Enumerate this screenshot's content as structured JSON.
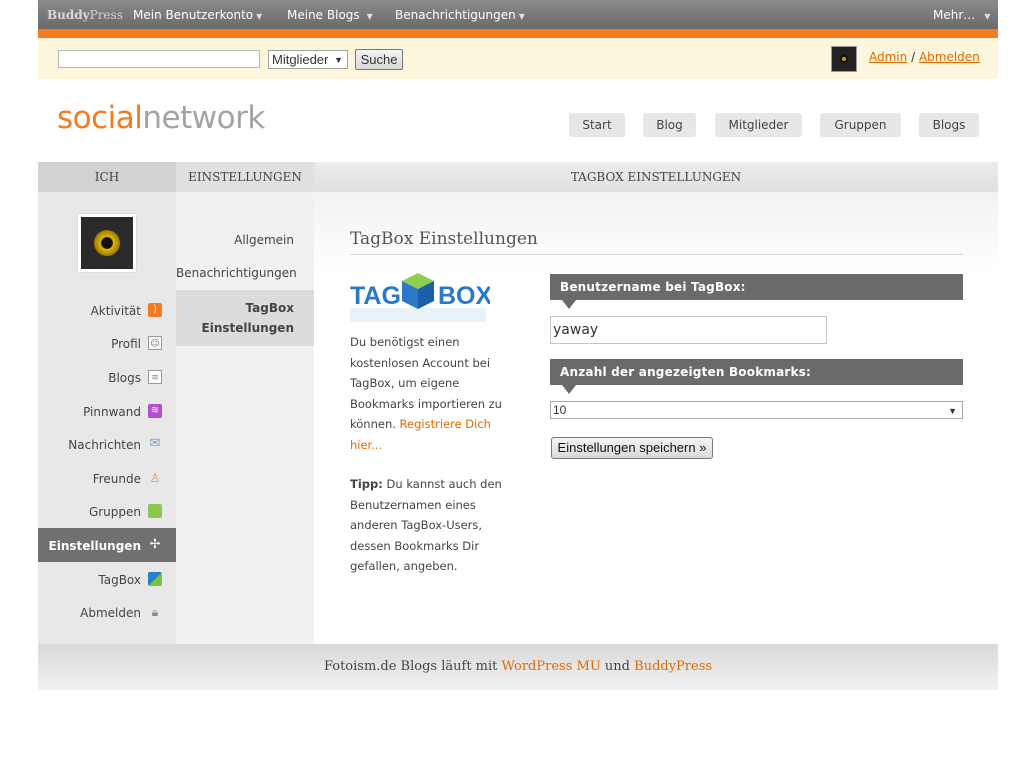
{
  "adminbar": {
    "logo_bold": "Buddy",
    "logo_rest": "Press",
    "items": [
      {
        "label": "Mein Benutzerkonto"
      },
      {
        "label": "Meine Blogs"
      },
      {
        "label": "Benachrichtigungen"
      }
    ],
    "more_label": "Mehr…",
    "accent_color": "#f47b20"
  },
  "search": {
    "input_value": "",
    "scope_selected": "Mitglieder",
    "button_label": "Suche"
  },
  "user": {
    "admin_link": "Admin",
    "separator": "/",
    "logout_link": "Abmelden"
  },
  "header": {
    "logo_part1": "social",
    "logo_part2": "network",
    "nav": [
      "Start",
      "Blog",
      "Mitglieder",
      "Gruppen",
      "Blogs"
    ]
  },
  "columns": {
    "ich": "ICH",
    "einstellungen": "EINSTELLUNGEN",
    "main": "TAGBOX EINSTELLUNGEN"
  },
  "sidebar": {
    "items": [
      {
        "label": "Aktivität",
        "icon": "rss-icon"
      },
      {
        "label": "Profil",
        "icon": "profile-icon"
      },
      {
        "label": "Blogs",
        "icon": "blogs-icon"
      },
      {
        "label": "Pinnwand",
        "icon": "wire-icon"
      },
      {
        "label": "Nachrichten",
        "icon": "mail-icon"
      },
      {
        "label": "Freunde",
        "icon": "friends-icon"
      },
      {
        "label": "Gruppen",
        "icon": "groups-icon"
      },
      {
        "label": "Einstellungen",
        "icon": "settings-icon",
        "active": true
      },
      {
        "label": "TagBox",
        "icon": "tagbox-icon"
      },
      {
        "label": "Abmelden",
        "icon": "lock-icon"
      }
    ]
  },
  "subnav": {
    "items": [
      {
        "label": "Allgemein"
      },
      {
        "label": "Benachrichtigungen"
      },
      {
        "label_line1": "TagBox",
        "label_line2": "Einstellungen",
        "active": true
      }
    ]
  },
  "main": {
    "title": "TagBox Einstellungen",
    "logo_text_left": "TAG",
    "logo_text_right": "BOX",
    "intro_text": "Du benötigst einen kostenlosen Account bei TagBox, um eigene Bookmarks importieren zu können.",
    "register_link": "Registriere Dich hier...",
    "tip_label": "Tipp:",
    "tip_text": "Du kannst auch den Benutzernamen eines anderen TagBox-Users, dessen Bookmarks Dir gefallen, angeben.",
    "username_heading": "Benutzername bei TagBox:",
    "username_value": "yaway",
    "count_heading": "Anzahl der angezeigten Bookmarks:",
    "count_selected": "10",
    "save_button": "Einstellungen speichern »"
  },
  "footer": {
    "text_before": "Fotoism.de Blogs läuft mit",
    "link1": "WordPress MU",
    "text_mid": "und",
    "link2": "BuddyPress"
  }
}
